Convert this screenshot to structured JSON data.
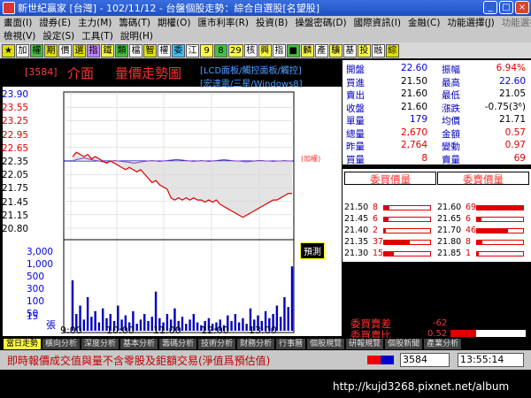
{
  "window": {
    "title": "新世紀贏家 [台灣] - 102/11/12 - 台盤個股走勢：綜合自選股[名望股]",
    "buttons": [
      "_",
      "□",
      "×"
    ]
  },
  "menu1": {
    "items": [
      "畫面(I)",
      "證券(E)",
      "主力(M)",
      "籌碼(T)",
      "期權(O)",
      "匯市利率(R)",
      "投資(B)",
      "操盤密碼(D)",
      "國際資訊(I)",
      "金融(C)",
      "功能選擇(J)"
    ],
    "right": "功能選擇"
  },
  "menu2": {
    "items": [
      "檢視(V)",
      "設定(S)",
      "工具(T)",
      "說明(H)"
    ]
  },
  "toolbar": {
    "buttons": [
      {
        "label": "★",
        "color": "#e0e000"
      },
      {
        "label": "加",
        "color": "#ffffff"
      },
      {
        "label": "權",
        "color": "#40c040"
      },
      {
        "label": "期",
        "color": "#e0e000"
      },
      {
        "label": "價",
        "color": "#ffffff"
      },
      {
        "label": "選",
        "color": "#e0e000"
      },
      {
        "label": "指",
        "color": "#c080ff"
      },
      {
        "label": "鐵",
        "color": "#ffff40"
      },
      {
        "label": "類",
        "color": "#40c040"
      },
      {
        "label": "檔",
        "color": "#ffffff"
      },
      {
        "label": "智",
        "color": "#e0e000"
      },
      {
        "label": "權",
        "color": "#ffffff"
      },
      {
        "label": "委",
        "color": "#40c0ff"
      },
      {
        "label": "江",
        "color": "#ffffff"
      },
      {
        "label": "9",
        "color": "#ffff40"
      },
      {
        "label": "8",
        "color": "#40c040"
      },
      {
        "label": "29",
        "color": "#ffff40"
      },
      {
        "label": "核",
        "color": "#ffffff"
      },
      {
        "label": "興",
        "color": "#ffff40"
      },
      {
        "label": "指",
        "color": "#ffffff"
      },
      {
        "label": "■",
        "color": "#40c040"
      },
      {
        "label": "麟",
        "color": "#ffff40"
      },
      {
        "label": "產",
        "color": "#ffffff"
      },
      {
        "label": "驥",
        "color": "#ffff40"
      },
      {
        "label": "基",
        "color": "#ffffff"
      },
      {
        "label": "投",
        "color": "#ffff40"
      },
      {
        "label": "融",
        "color": "#ffffff"
      },
      {
        "label": "綜",
        "color": "#e0e000"
      }
    ]
  },
  "header": {
    "code": "[3584]",
    "name": "介面",
    "chart_title": "量價走勢圖",
    "sub1": "[LCD面板/觸控面板/觸控]",
    "sub2": "[宏達電/三星/Windows8]"
  },
  "chart": {
    "price_labels": [
      {
        "text": "23.90",
        "color": "blue"
      },
      {
        "text": "23.55",
        "color": "red"
      },
      {
        "text": "23.25",
        "color": "red"
      },
      {
        "text": "22.95",
        "color": "red"
      },
      {
        "text": "22.65",
        "color": "red"
      },
      {
        "text": "22.35",
        "color": "dark"
      },
      {
        "text": "22.05",
        "color": "dark"
      },
      {
        "text": "21.75",
        "color": "dark"
      },
      {
        "text": "21.45",
        "color": "dark"
      },
      {
        "text": "21.15",
        "color": "dark"
      },
      {
        "text": "20.80",
        "color": "dark"
      }
    ],
    "volume_labels": [
      "3,000",
      "1,000",
      "500",
      "300",
      "100",
      "50",
      "15"
    ],
    "volume_unit": "張",
    "time_labels": [
      "9:00",
      "10:00",
      "11:00",
      "12:00",
      "13:00"
    ],
    "predict_button": "預測",
    "jiama_label": "(加權)",
    "colors": {
      "price_line": "#e00000",
      "index_line": "#8040c0",
      "ref_line": "#0000c0",
      "volume": "#0000c0"
    }
  },
  "quote": {
    "rows": [
      {
        "l1": "開盤",
        "v1": "22.60",
        "c1": "blue",
        "l2": "振幅",
        "v2": "6.94%",
        "c2": "red"
      },
      {
        "l1": "買進",
        "v1": "21.50",
        "c1": "dark",
        "l2": "最高",
        "v2": "22.60",
        "c2": "blue"
      },
      {
        "l1": "賣出",
        "v1": "21.60",
        "c1": "dark",
        "l2": "最低",
        "v2": "21.05",
        "c2": "dark"
      },
      {
        "l1": "收盤",
        "v1": "21.60",
        "c1": "dark",
        "l2": "漲跌",
        "v2": "-0.75(3⁶)",
        "c2": "dark"
      },
      {
        "l1": "單量",
        "v1": "179",
        "c1": "blue",
        "l2": "均價",
        "v2": "21.71",
        "c2": "dark"
      },
      {
        "l1": "總量",
        "v1": "2,670",
        "c1": "red",
        "l2": "金額",
        "v2": "0.57",
        "c2": "red"
      },
      {
        "l1": "昨量",
        "v1": "2,764",
        "c1": "red",
        "l2": "變動",
        "v2": "0.97",
        "c2": "red"
      },
      {
        "l1": "買量",
        "v1": "8",
        "c1": "red",
        "l2": "賣量",
        "v2": "69",
        "c2": "red"
      }
    ]
  },
  "bidask": {
    "bid_head": "委買價量",
    "ask_head": "委賣價量",
    "bids": [
      {
        "price": "21.50",
        "qty": "8",
        "level": 0.12
      },
      {
        "price": "21.45",
        "qty": "6",
        "level": 0.09
      },
      {
        "price": "21.40",
        "qty": "2",
        "level": 0.04
      },
      {
        "price": "21.35",
        "qty": "37",
        "level": 0.55
      },
      {
        "price": "21.30",
        "qty": "15",
        "level": 0.22
      }
    ],
    "asks": [
      {
        "price": "21.60",
        "qty": "69",
        "level": 1.0
      },
      {
        "price": "21.65",
        "qty": "6",
        "level": 0.09
      },
      {
        "price": "21.70",
        "qty": "46",
        "level": 0.67
      },
      {
        "price": "21.80",
        "qty": "8",
        "level": 0.12
      },
      {
        "price": "21.85",
        "qty": "1",
        "level": 0.02
      }
    ],
    "diff_label": "委買賣差",
    "diff_value": "-62",
    "ratio_label": "委買賣比",
    "ratio_value": "0.52",
    "ratio_level": 0.34
  },
  "tabs": [
    "當日走勢",
    "橫向分析",
    "深度分析",
    "基本分析",
    "籌碼分析",
    "技術分析",
    "財務分析",
    "行事曆",
    "個股規覽",
    "研報規覽",
    "個股新聞",
    "產業分析"
  ],
  "status": {
    "message": "即時報價成交值與量不含零股及鉅額交易(淨值爲預估值)",
    "code": "3584",
    "time": "13:55:14"
  },
  "footer": {
    "watermark": "http://kujd3268.pixnet.net/album"
  },
  "chart_data": {
    "type": "line",
    "x": [
      "9:00",
      "10:00",
      "11:00",
      "12:00",
      "13:00"
    ],
    "ylim": [
      20.8,
      23.9
    ],
    "reference_price": 22.35,
    "series": [
      {
        "values": [
          22.45,
          22.55,
          22.5,
          22.45,
          22.5,
          22.4,
          22.45,
          22.4,
          22.35,
          22.3,
          22.35,
          22.3,
          22.25,
          22.2,
          22.15,
          22.2,
          22.15,
          22.1,
          22.15,
          22.05,
          21.95,
          21.85,
          21.9,
          21.8,
          21.75,
          21.7,
          21.5,
          21.45,
          21.5,
          21.45,
          21.5,
          21.45,
          21.5,
          21.45,
          21.45,
          21.4,
          21.45,
          21.4,
          21.45,
          21.35,
          21.3,
          21.25,
          21.2,
          21.15,
          21.1,
          21.05,
          21.1,
          21.15,
          21.2,
          21.25,
          21.3,
          21.35,
          21.4,
          21.45,
          21.45,
          21.5,
          21.55,
          21.6,
          21.6
        ]
      },
      {
        "values": [
          22.35,
          22.38,
          22.4,
          22.42,
          22.4,
          22.38,
          22.36,
          22.35,
          22.33,
          22.32,
          22.34,
          22.36,
          22.35,
          22.34,
          22.33,
          22.32,
          22.3,
          22.31,
          22.33,
          22.34,
          22.35,
          22.36,
          22.35,
          22.34,
          22.35,
          22.36,
          22.37,
          22.38,
          22.38,
          22.37,
          22.36,
          22.35,
          22.34,
          22.35,
          22.36,
          22.35,
          22.34,
          22.35,
          22.36,
          22.37,
          22.38,
          22.37,
          22.36,
          22.35,
          22.35,
          22.34,
          22.33,
          22.34,
          22.35,
          22.36,
          22.36,
          22.35,
          22.35,
          22.34,
          22.35,
          22.35,
          22.36,
          22.35,
          22.35
        ]
      }
    ],
    "volume": [
      180,
      60,
      90,
      40,
      120,
      50,
      70,
      30,
      80,
      45,
      60,
      35,
      90,
      40,
      55,
      30,
      70,
      25,
      40,
      60,
      35,
      50,
      140,
      45,
      30,
      60,
      40,
      80,
      35,
      50,
      25,
      40,
      60,
      30,
      20,
      35,
      45,
      25,
      30,
      40,
      20,
      55,
      35,
      60,
      30,
      45,
      25,
      80,
      40,
      55,
      35,
      70,
      45,
      60,
      90,
      50,
      120,
      85,
      230
    ]
  }
}
